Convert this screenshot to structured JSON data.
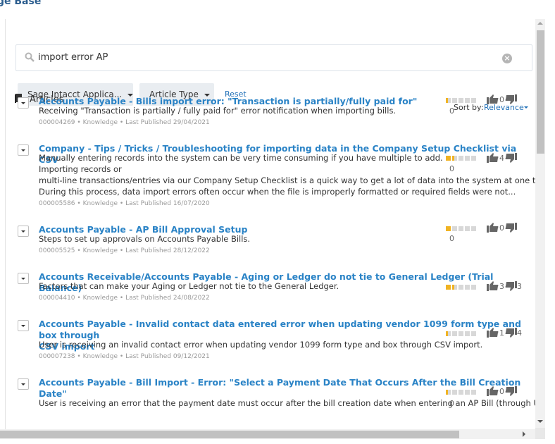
{
  "page": {
    "title": "ge Base"
  },
  "search": {
    "value": "import error AP",
    "clear_label": "×"
  },
  "filters": [
    {
      "label": "Sage Intacct Applica..."
    },
    {
      "label": "Article Type"
    }
  ],
  "reset_label": "Reset",
  "section": {
    "label": "Articles"
  },
  "sort": {
    "label": "Sort by:",
    "value": "Relevance"
  },
  "colors": {
    "link": "#2a83c6",
    "rating": "#f0b323",
    "rating_empty": "#d8d8d8"
  },
  "articles": [
    {
      "title": "Accounts Payable - Bills import error: \"Transaction is partially/fully paid for\"",
      "summary": [
        "Receiving \"Transaction is partially / fully paid for\" error notification when importing bills."
      ],
      "meta": "000004269 • Knowledge • Last Published 29/04/2021",
      "rating": 0.2,
      "rating_count": "0",
      "up": "0",
      "down": ""
    },
    {
      "title": "Company - Tips / Tricks / Troubleshooting for importing data in the Company Setup Checklist via CSV",
      "summary": [
        "Manually entering records into the system can be very time consuming if you have multiple to add.",
        "Importing records or",
        "multi-line transactions/entries via our Company Setup Checklist is a quick way to get a lot of data into the system at one time.",
        "During this process, data import errors often occur when the file is improperly formatted or required fields were not..."
      ],
      "meta": "000005586 • Knowledge • Last Published 16/07/2020",
      "rating": 1.5,
      "rating_count": "0",
      "up": "4",
      "down": ""
    },
    {
      "title": "Accounts Payable - AP Bill Approval Setup",
      "summary": [
        "Steps to set up approvals on Accounts Payable Bills."
      ],
      "meta": "000005525 • Knowledge • Last Published 28/12/2022",
      "rating": 1,
      "rating_count": "0",
      "up": "0",
      "down": ""
    },
    {
      "title": "Accounts Receivable/Accounts Payable - Aging or Ledger do not tie to General Ledger (Trial Balance)",
      "summary": [
        "Factors that can make your Aging or Ledger not tie to the General Ledger."
      ],
      "meta": "000004410 • Knowledge • Last Published 24/08/2022",
      "rating": 1.5,
      "rating_count": "",
      "up": "3",
      "down": "3"
    },
    {
      "title_lines": [
        "Accounts Payable - Invalid contact data entered error when updating vendor 1099 form type and box through",
        "CSV import"
      ],
      "summary": [
        "User is receiving an invalid contact error when updating vendor 1099 form type and box through CSV import."
      ],
      "meta": "000007238 • Knowledge • Last Published 09/12/2021",
      "rating": 0.2,
      "rating_count": "",
      "up": "1",
      "down": "4"
    },
    {
      "title_lines": [
        "Accounts Payable - Bill Import - Error: \"Select a Payment Date That Occurs After the Bill Creation",
        "Date\""
      ],
      "summary": [
        "User is receiving an error that the payment date must occur after the bill creation date when entering an AP Bill (through UI or"
      ],
      "meta": "",
      "rating": 0.2,
      "rating_count": "0",
      "up": "0",
      "down": ""
    }
  ]
}
